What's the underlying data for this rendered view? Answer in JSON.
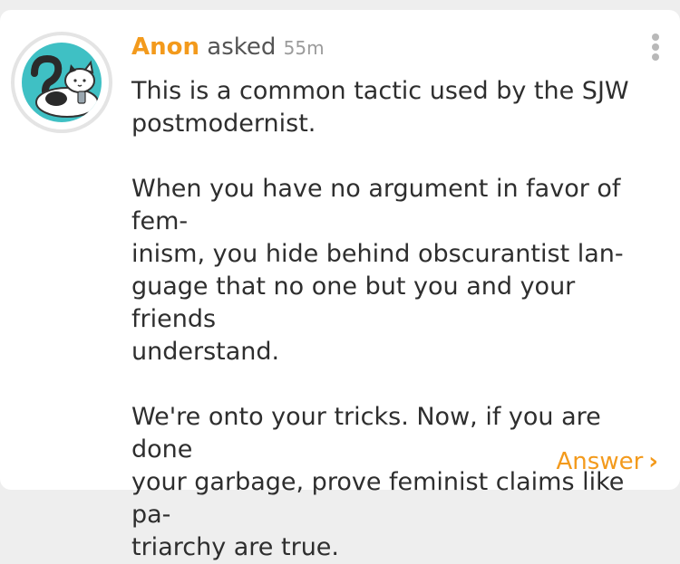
{
  "question": {
    "author": "Anon",
    "action": "asked",
    "time": "55m",
    "paragraphs": [
      "This is a common tactic used by the SJW\npostmodernist.",
      "When you have no argument in favor of fem-\ninism, you hide behind obscurantist lan-\nguage that no one but you and your friends\nunderstand.",
      "We're onto your tricks. Now, if you are done\nyour garbage, prove feminist claims like pa-\ntriarchy are true."
    ]
  },
  "actions": {
    "answer_label": "Answer",
    "answer_icon": "chevron-right-icon",
    "menu_icon": "more-vertical-icon"
  },
  "avatar": {
    "icon": "question-cat-avatar",
    "background": "#3fc0c4"
  },
  "colors": {
    "accent": "#f39a1c",
    "text": "#2e2e2e",
    "muted": "#9b9b9b",
    "background": "#eeeeee"
  }
}
